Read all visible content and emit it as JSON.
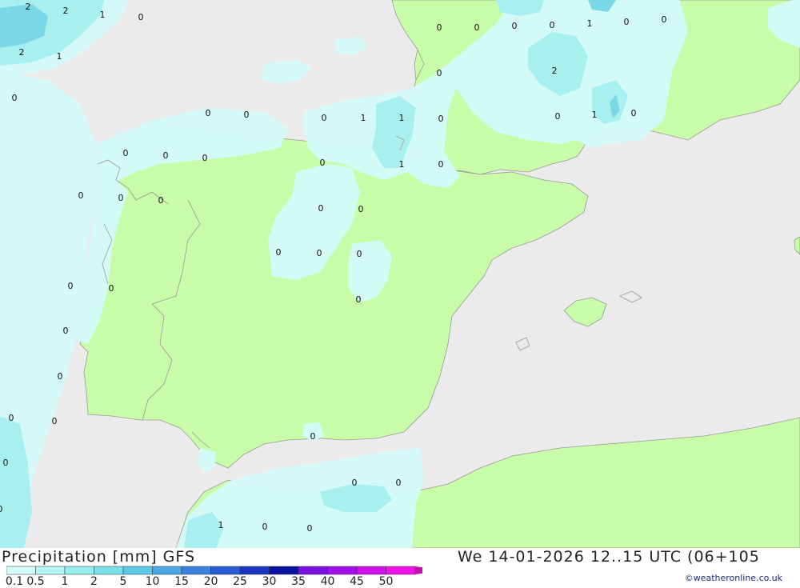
{
  "header": {
    "title_left": "Precipitation [mm] GFS",
    "title_right": "We 14-01-2026 12..15 UTC (06+105"
  },
  "credit": "©weatheronline.co.uk",
  "legend": {
    "labels": [
      "0.1",
      "0.5",
      "1",
      "2",
      "5",
      "10",
      "15",
      "20",
      "25",
      "30",
      "35",
      "40",
      "45",
      "50"
    ],
    "colors": [
      "#d4fafa",
      "#b4f5f5",
      "#96eeee",
      "#7adfe8",
      "#5cc8e6",
      "#4aa8e4",
      "#3a82dc",
      "#2a5cd4",
      "#1a36c0",
      "#0a12a0",
      "#7a10e0",
      "#a010e8",
      "#d010e8",
      "#f010e8",
      "#c010b0"
    ]
  },
  "map": {
    "colors": {
      "sea": "#ebebeb",
      "land": "#c8fca8",
      "precip_light": "#d4fafa",
      "precip_mid": "#a8f0f0",
      "precip_high": "#7ad8e6",
      "coast": "#999999"
    },
    "values": [
      {
        "t": "2"
      },
      {
        "t": "2"
      },
      {
        "t": "1"
      },
      {
        "t": "0"
      },
      {
        "t": "2"
      },
      {
        "t": "1"
      },
      {
        "t": "0"
      },
      {
        "t": "0"
      },
      {
        "t": "0"
      },
      {
        "t": "0"
      },
      {
        "t": "0"
      },
      {
        "t": "1"
      },
      {
        "t": "0"
      },
      {
        "t": "0"
      },
      {
        "t": "0"
      },
      {
        "t": "2"
      },
      {
        "t": "0"
      },
      {
        "t": "1"
      },
      {
        "t": "0"
      },
      {
        "t": "0"
      },
      {
        "t": "0"
      },
      {
        "t": "0"
      },
      {
        "t": "1"
      },
      {
        "t": "1"
      },
      {
        "t": "0"
      },
      {
        "t": "0"
      },
      {
        "t": "0"
      },
      {
        "t": "0"
      },
      {
        "t": "0"
      },
      {
        "t": "1"
      },
      {
        "t": "0"
      },
      {
        "t": "0"
      },
      {
        "t": "0"
      },
      {
        "t": "0"
      },
      {
        "t": "0"
      },
      {
        "t": "0"
      },
      {
        "t": "0"
      },
      {
        "t": "0"
      },
      {
        "t": "0"
      },
      {
        "t": "0"
      },
      {
        "t": "0"
      },
      {
        "t": "0"
      },
      {
        "t": "0"
      },
      {
        "t": "0"
      },
      {
        "t": "0"
      },
      {
        "t": "0"
      },
      {
        "t": "0"
      },
      {
        "t": "0"
      },
      {
        "t": "0"
      },
      {
        "t": "0"
      },
      {
        "t": "1"
      },
      {
        "t": "0"
      },
      {
        "t": "0"
      },
      {
        "t": "0"
      }
    ]
  }
}
